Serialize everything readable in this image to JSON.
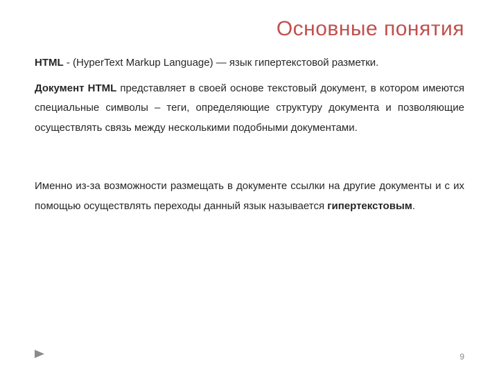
{
  "title": "Основные понятия",
  "para1_bold": "HTML",
  "para1_rest": " - (HyperText Markup Language) — язык гипертекстовой разметки.",
  "para2_bold": "Документ HTML",
  "para2_rest": " представляет в своей основе текстовый документ, в котором имеются специальные символы – теги, определяющие структуру документа и позволяющие осуществлять связь между несколькими подобными документами.",
  "para3_pre": "Именно из-за возможности размещать в документе ссылки на другие документы и с их помощью осуществлять переходы данный язык называется ",
  "para3_bold": "гипертекстовым",
  "para3_post": ".",
  "page_number": "9"
}
